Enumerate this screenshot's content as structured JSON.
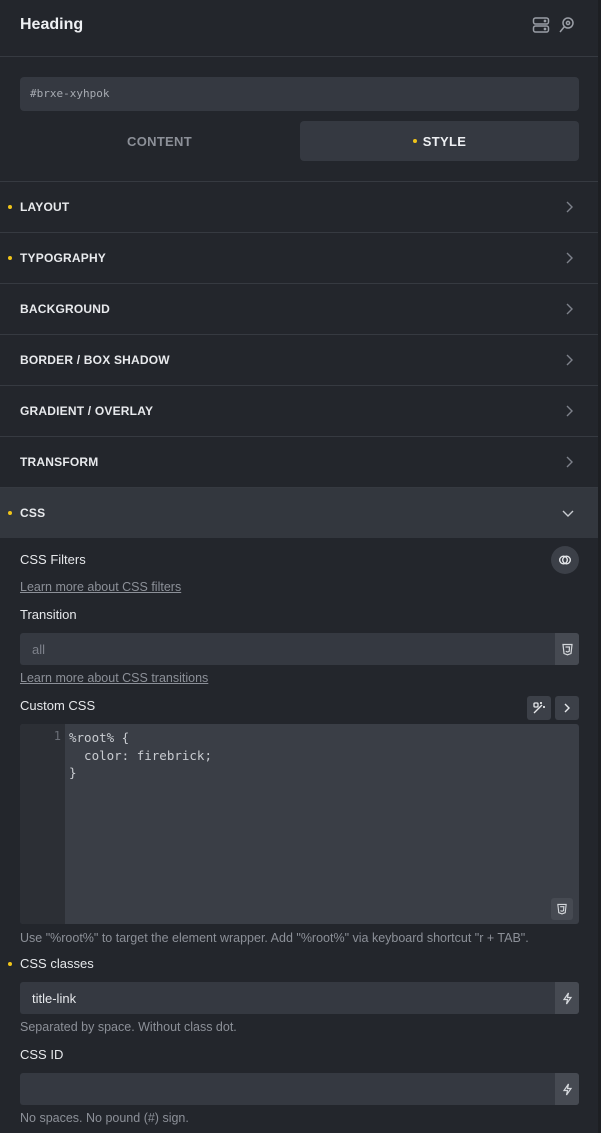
{
  "header": {
    "title": "Heading"
  },
  "element_id": "#brxe-xyhpok",
  "tabs": {
    "content": "CONTENT",
    "style": "STYLE"
  },
  "sections": [
    {
      "label": "LAYOUT",
      "modified": true
    },
    {
      "label": "TYPOGRAPHY",
      "modified": true
    },
    {
      "label": "BACKGROUND",
      "modified": false
    },
    {
      "label": "BORDER / BOX SHADOW",
      "modified": false
    },
    {
      "label": "GRADIENT / OVERLAY",
      "modified": false
    },
    {
      "label": "TRANSFORM",
      "modified": false
    },
    {
      "label": "CSS",
      "modified": true,
      "open": true
    }
  ],
  "css_panel": {
    "filters_label": "CSS Filters",
    "filters_link": "Learn more about CSS filters",
    "transition_label": "Transition",
    "transition_placeholder": "all",
    "transition_link": "Learn more about CSS transitions",
    "custom_css_label": "Custom CSS",
    "line_number": "1",
    "code": "%root% {\n  color: firebrick;\n}",
    "custom_css_help": "Use \"%root%\" to target the element wrapper. Add \"%root%\" via keyboard shortcut \"r + TAB\".",
    "classes_label": "CSS classes",
    "classes_value": "title-link",
    "classes_help": "Separated by space. Without class dot.",
    "id_label": "CSS ID",
    "id_value": "",
    "id_help": "No spaces. No pound (#) sign."
  },
  "colors": {
    "accent_dot": "#f0c419",
    "background": "#23262c",
    "panel": "#353941"
  }
}
